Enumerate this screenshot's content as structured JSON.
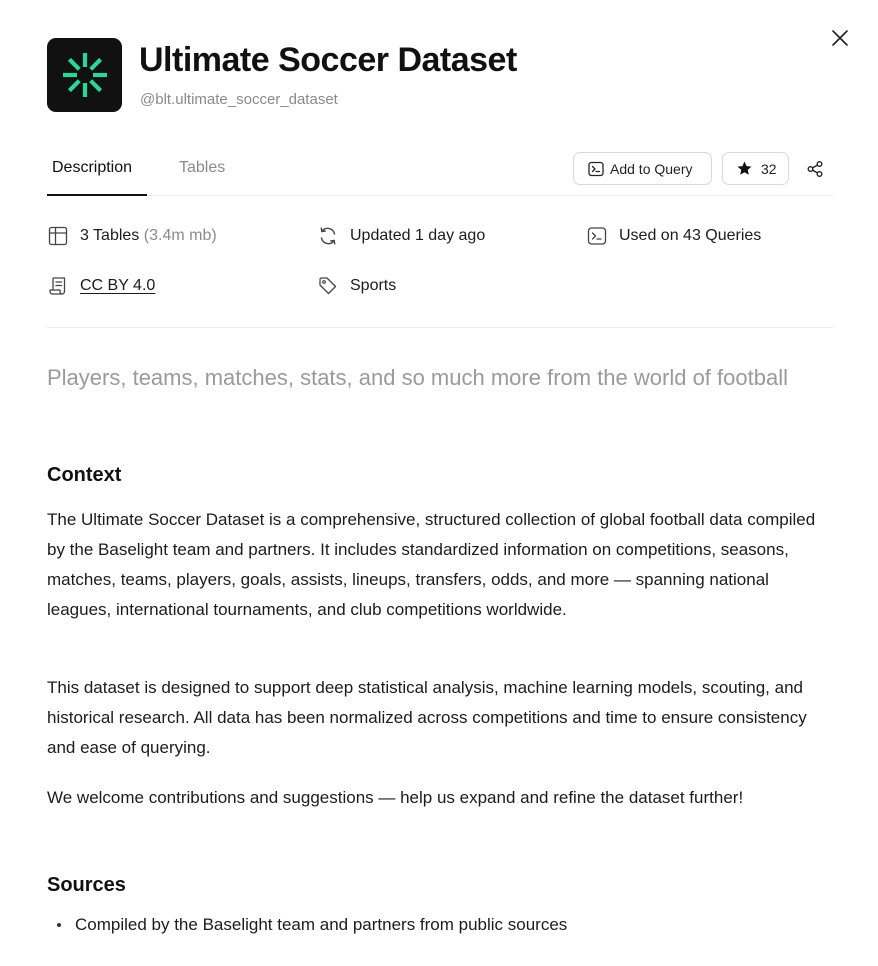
{
  "dataset": {
    "title": "Ultimate Soccer Dataset",
    "handle": "@blt.ultimate_soccer_dataset",
    "logo_color": "#2ED49A"
  },
  "tabs": [
    {
      "label": "Description",
      "active": true
    },
    {
      "label": "Tables",
      "active": false
    }
  ],
  "actions": {
    "add_to_query": "Add to Query",
    "star_count": "32"
  },
  "meta": {
    "tables_label": "3 Tables",
    "tables_size": "(3.4m mb)",
    "updated": "Updated 1 day ago",
    "queries": "Used on 43 Queries",
    "license": "CC BY 4.0",
    "category": "Sports"
  },
  "content": {
    "tagline": "Players, teams, matches, stats, and so much more from the world of football",
    "context_heading": "Context",
    "context_paragraphs": [
      "The Ultimate Soccer Dataset is a comprehensive, structured collection of global football data compiled by the Baselight team and partners. It includes standardized information on competitions, seasons, matches, teams, players, goals, assists, lineups, transfers, odds, and more — spanning national leagues, international tournaments, and club competitions worldwide.",
      "This dataset is designed to support deep statistical analysis, machine learning models, scouting, and historical research. All data has been normalized across competitions and time to ensure consistency and ease of querying.",
      "We welcome contributions and suggestions — help us expand and refine the dataset further!"
    ],
    "sources_heading": "Sources",
    "sources": [
      "Compiled by the Baselight team and partners from public sources"
    ]
  }
}
